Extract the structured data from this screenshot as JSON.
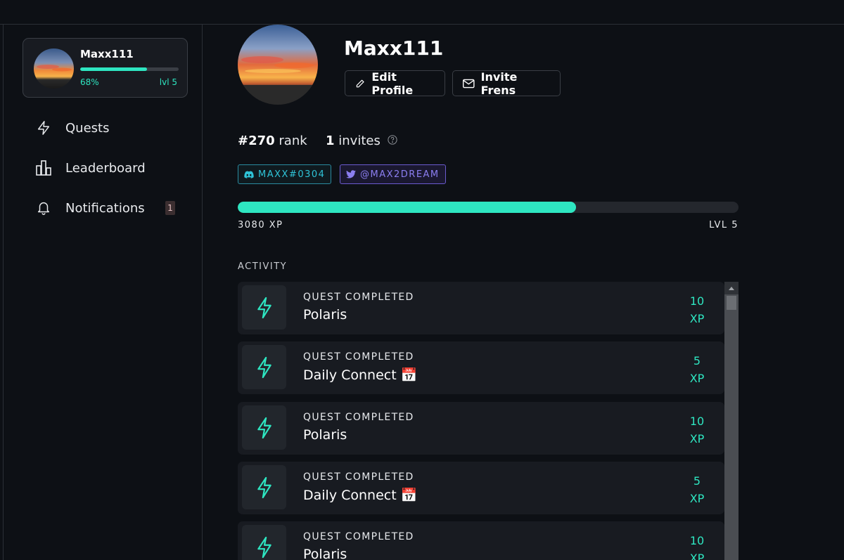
{
  "user": {
    "name": "Maxx111",
    "progress_fraction": 0.68,
    "progress_label": "68%",
    "level_short": "lvl 5"
  },
  "nav": {
    "items": [
      {
        "label": "Quests",
        "icon": "lightning-icon"
      },
      {
        "label": "Leaderboard",
        "icon": "chart-bars-icon"
      },
      {
        "label": "Notifications",
        "icon": "bell-icon",
        "badge": "1"
      }
    ]
  },
  "profile": {
    "username": "Maxx111",
    "edit_label": "Edit Profile",
    "invite_label": "Invite Frens",
    "rank_number": "#270",
    "rank_word": "rank",
    "invites_number": "1",
    "invites_word": "invites",
    "discord_handle": "MAXX#0304",
    "twitter_handle": "@MAX2DREAM",
    "xp_fraction": 0.675,
    "xp_label": "3080 XP",
    "level_label": "LVL 5"
  },
  "activity": {
    "heading": "ACTIVITY",
    "items": [
      {
        "label": "QUEST COMPLETED",
        "title": "Polaris",
        "xp_value": "10",
        "xp_unit": "XP"
      },
      {
        "label": "QUEST COMPLETED",
        "title": "Daily Connect 📅",
        "xp_value": "5",
        "xp_unit": "XP"
      },
      {
        "label": "QUEST COMPLETED",
        "title": "Polaris",
        "xp_value": "10",
        "xp_unit": "XP"
      },
      {
        "label": "QUEST COMPLETED",
        "title": "Daily Connect 📅",
        "xp_value": "5",
        "xp_unit": "XP"
      },
      {
        "label": "QUEST COMPLETED",
        "title": "Polaris",
        "xp_value": "10",
        "xp_unit": "XP"
      }
    ]
  },
  "colors": {
    "accent": "#2ee6c1",
    "discord": "#2fc4d8",
    "twitter": "#8b7ef0",
    "background": "#0d1015"
  }
}
